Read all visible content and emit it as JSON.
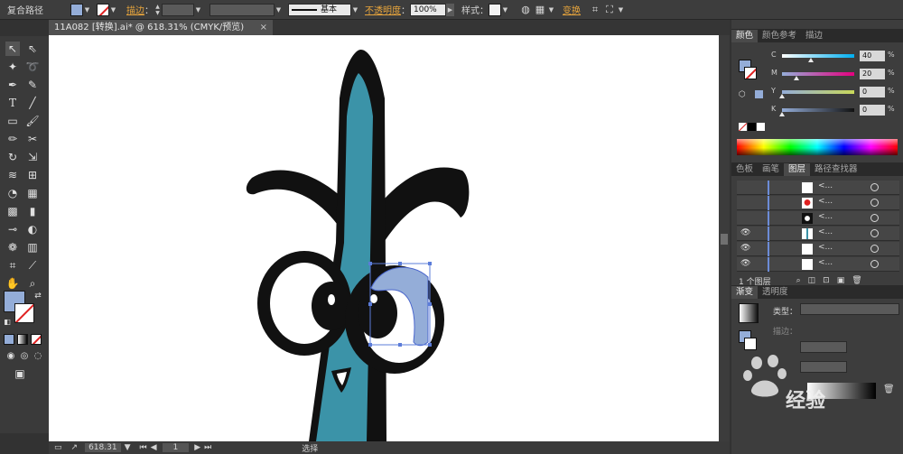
{
  "control_bar": {
    "object_type": "复合路径",
    "stroke_label": "描边",
    "stroke_style": "基本",
    "opacity_label": "不透明度",
    "opacity_value": "100%",
    "style_label": "样式",
    "transform_link": "变换",
    "fill_color": "#94add8"
  },
  "document_tab": {
    "title": "11A082 [转换].ai* @ 618.31% (CMYK/预览)",
    "close": "×"
  },
  "status_bar": {
    "zoom": "618.31",
    "page": "1",
    "tool_name": "选择"
  },
  "color_panel": {
    "tabs": [
      "颜色",
      "颜色参考",
      "描边"
    ],
    "active_tab": 0,
    "channels": [
      {
        "name": "C",
        "value": "40",
        "unit": "%",
        "level": 0.4
      },
      {
        "name": "M",
        "value": "20",
        "unit": "%",
        "level": 0.2
      },
      {
        "name": "Y",
        "value": "0",
        "unit": "%",
        "level": 0.0
      },
      {
        "name": "K",
        "value": "0",
        "unit": "%",
        "level": 0.0
      }
    ]
  },
  "layers_panel": {
    "tabs": [
      "色板",
      "画笔",
      "图层",
      "路径查找器"
    ],
    "active_tab": 2,
    "rows": [
      {
        "name": "<...",
        "visible": false
      },
      {
        "name": "<...",
        "visible": false
      },
      {
        "name": "<...",
        "visible": false
      },
      {
        "name": "<...",
        "visible": true
      },
      {
        "name": "<...",
        "visible": true
      },
      {
        "name": "<...",
        "visible": true
      },
      {
        "name": "<...",
        "visible": true
      }
    ],
    "footer": "1 个图层"
  },
  "gradient_panel": {
    "tabs": [
      "渐变",
      "透明度"
    ],
    "active_tab": 0,
    "type_label": "类型：",
    "stroke_label": "描边："
  },
  "watermark": {
    "text": "经验"
  },
  "colors": {
    "teal": "#3b93a8",
    "fill": "#94add8"
  }
}
